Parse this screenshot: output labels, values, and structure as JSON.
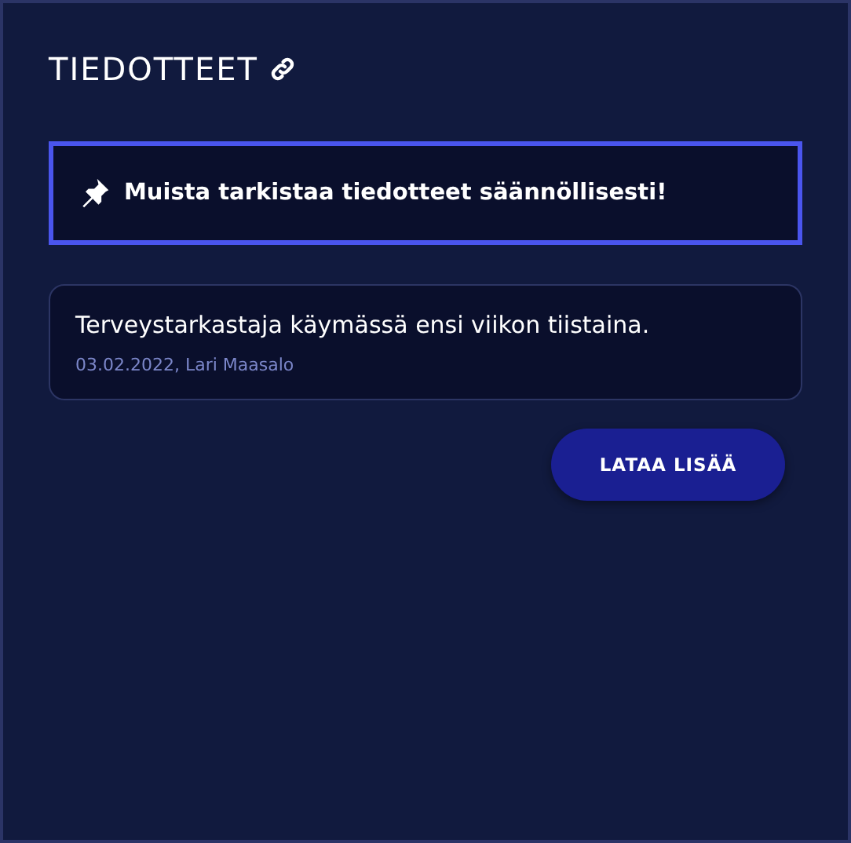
{
  "title": "TIEDOTTEET",
  "notice": "Muista tarkistaa tiedotteet säännöllisesti!",
  "announcements": [
    {
      "text": "Terveystarkastaja käymässä ensi viikon tiistaina.",
      "meta": "03.02.2022, Lari Maasalo"
    }
  ],
  "load_more_button": "LATAA LISÄÄ"
}
